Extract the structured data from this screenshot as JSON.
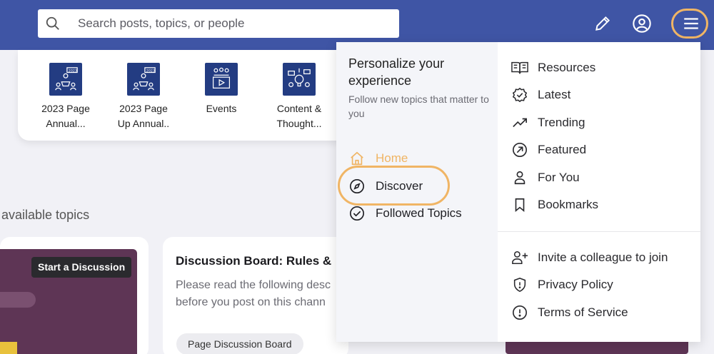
{
  "header": {
    "search_placeholder": "Search posts, topics, or people"
  },
  "topics": [
    {
      "label_line1": "2023 Page",
      "label_line2": "Annual..."
    },
    {
      "label_line1": "2023 Page",
      "label_line2": "Up Annual.."
    },
    {
      "label_line1": "Events",
      "label_line2": ""
    },
    {
      "label_line1": "Content &",
      "label_line2": "Thought..."
    }
  ],
  "available_topics_label": "available topics",
  "cards": {
    "start_discussion_label": "Start a Discussion",
    "discussion_title": "Discussion Board: Rules &",
    "discussion_desc_line1": "Please read the following desc",
    "discussion_desc_line2": "before you post on this chann",
    "chip_label": "Page Discussion Board"
  },
  "menu": {
    "personalize_title": "Personalize your experience",
    "personalize_sub": "Follow new topics that matter to you",
    "nav": [
      {
        "label": "Home",
        "icon": "home-icon",
        "active": true
      },
      {
        "label": "Discover",
        "icon": "compass-icon",
        "active": false
      },
      {
        "label": "Followed Topics",
        "icon": "check-circle-icon",
        "active": false
      }
    ],
    "items": [
      {
        "label": "Resources",
        "icon": "book-icon"
      },
      {
        "label": "Latest",
        "icon": "badge-check-icon"
      },
      {
        "label": "Trending",
        "icon": "trending-icon"
      },
      {
        "label": "Featured",
        "icon": "arrow-circle-icon"
      },
      {
        "label": "For You",
        "icon": "user-icon"
      },
      {
        "label": "Bookmarks",
        "icon": "bookmark-icon"
      }
    ],
    "footer_items": [
      {
        "label": "Invite a colleague to join",
        "icon": "user-plus-icon"
      },
      {
        "label": "Privacy Policy",
        "icon": "shield-icon"
      },
      {
        "label": "Terms of Service",
        "icon": "alert-circle-icon"
      }
    ]
  },
  "colors": {
    "header": "#3f55a5",
    "highlight_ring": "#f0b565",
    "home_active": "#f0b565",
    "card_image": "#5e3555"
  }
}
